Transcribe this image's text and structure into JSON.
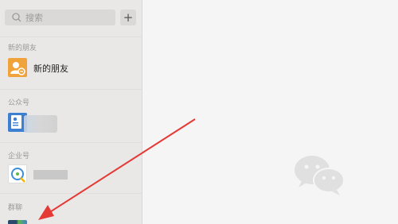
{
  "search": {
    "placeholder": "搜索",
    "icon": "search-icon"
  },
  "add_button": {
    "label": "+"
  },
  "sections": {
    "new_friends": {
      "header": "新的朋友",
      "item_label": "新的朋友",
      "icon": "add-friend-icon"
    },
    "official_accounts": {
      "header": "公众号",
      "icon": "official-account-icon"
    },
    "enterprise_accounts": {
      "header": "企业号",
      "icon": "enterprise-account-icon"
    },
    "group_chats": {
      "header": "群聊"
    }
  },
  "colors": {
    "sidebar_bg": "#e9e8e7",
    "main_bg": "#f5f5f5",
    "new_friend_avatar": "#f0a33a",
    "official_avatar": "#3d7fd1",
    "arrow": "#e53935"
  },
  "main_panel": {
    "logo": "wechat-logo-icon"
  }
}
